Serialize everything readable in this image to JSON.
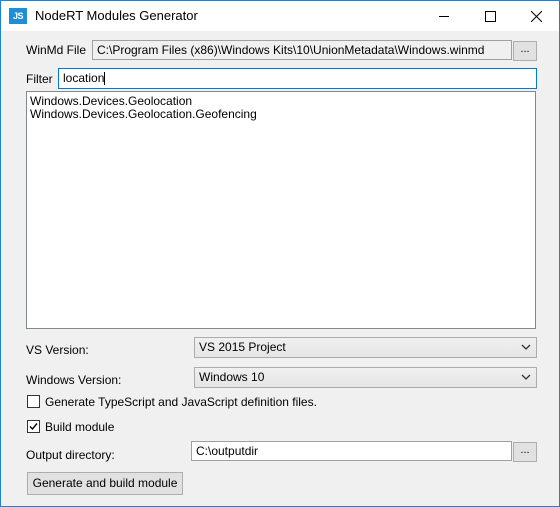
{
  "window": {
    "title": "NodeRT Modules Generator",
    "icon_text": "JS",
    "minimize": "minimize-icon",
    "maximize": "maximize-icon",
    "close": "close-icon"
  },
  "winmd": {
    "label": "WinMd File",
    "value": "C:\\Program Files (x86)\\Windows Kits\\10\\UnionMetadata\\Windows.winmd",
    "browse_label": "..."
  },
  "filter": {
    "label": "Filter",
    "value": "location"
  },
  "namespaces": {
    "items": [
      "Windows.Devices.Geolocation",
      "Windows.Devices.Geolocation.Geofencing"
    ]
  },
  "vs_version": {
    "label": "VS Version:",
    "selected": "VS 2015 Project"
  },
  "windows_version": {
    "label": "Windows Version:",
    "selected": "Windows 10"
  },
  "typescript_option": {
    "label": "Generate TypeScript and JavaScript definition files.",
    "checked": false
  },
  "build_option": {
    "label": "Build module",
    "checked": true
  },
  "output": {
    "label": "Output directory:",
    "value": "C:\\outputdir",
    "browse_label": "..."
  },
  "actions": {
    "generate_label": "Generate and build module"
  },
  "colors": {
    "accent": "#0078d7",
    "icon_bg": "#1e8fd6"
  }
}
